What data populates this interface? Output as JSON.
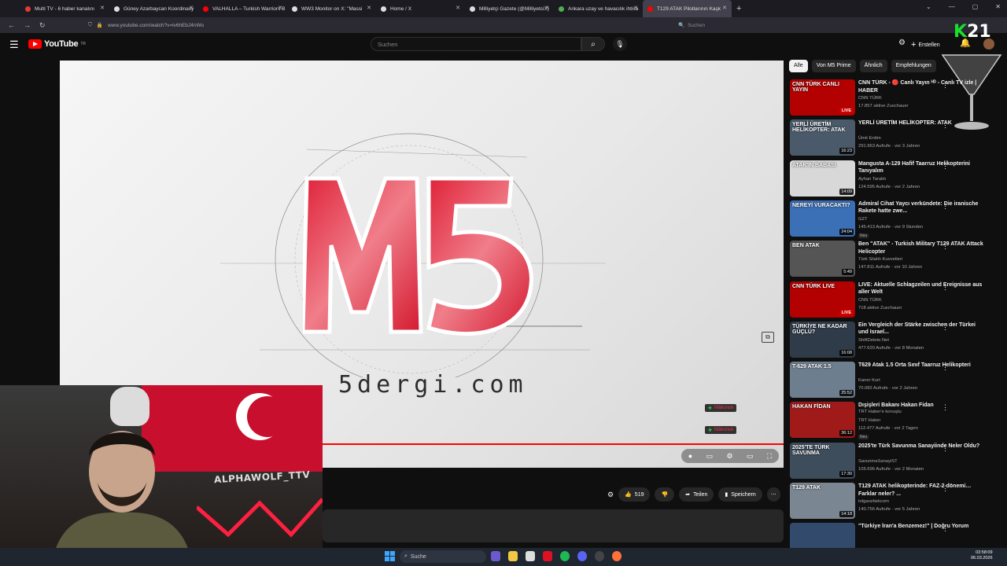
{
  "browser": {
    "tabs": [
      {
        "label": "Multi TV - 6 haber kanalını",
        "color": "#e53935"
      },
      {
        "label": "Güney Azarbaycan Koordinasy",
        "color": "#ffffff"
      },
      {
        "label": "VALHALLA – Turkish Warriors B",
        "color": "#ff0000"
      },
      {
        "label": "WW3 Monitor on X: \"Massi",
        "color": "#ffffff"
      },
      {
        "label": "Home / X",
        "color": "#ffffff"
      },
      {
        "label": "Milliyetçi Gazete (@MilliyetciX)",
        "color": "#ffffff"
      },
      {
        "label": "Ankara uzay ve havacılık ihtisa",
        "color": "#4caf50"
      },
      {
        "label": "T129 ATAK Pilotlarının Kaşk",
        "color": "#ff0000"
      }
    ],
    "url": "www.youtube.com/watch?v=lv6hEbJ4nWo",
    "search_placeholder": "Suchen"
  },
  "header": {
    "logo": "YouTube",
    "logo_country": "TR",
    "search_placeholder": "Suchen",
    "create_label": "Erstellen"
  },
  "player": {
    "site_text": "5dergi.com",
    "logo_text": "M5",
    "chat_1": "Mâkonuk",
    "chat_2": "Mâkonuk",
    "streamer_tag": "ALPHAWOLF_TTV"
  },
  "actions": {
    "likes": "519",
    "share": "Teilen",
    "save": "Speichern"
  },
  "chips": [
    "Alle",
    "Von M5 Prime",
    "Ähnlich",
    "Empfehlungen"
  ],
  "videos": [
    {
      "title": "CNN TÜRK - 🔴 Canlı Yayın ᴴᴰ - Canlı TV izle | HABER",
      "channel": "CNN TÜRK",
      "meta": "17.857 aktive Zuschauer",
      "badge": "LIVE",
      "thumb_text": "CNN TÜRK CANLI YAYIN",
      "thumb_color": "#b30000"
    },
    {
      "title": "YERLİ ÜRETİM HELİKOPTER: ATAK",
      "channel": "Ümit Erdim",
      "meta": "291.963 Aufrufe · vor 3 Jahren",
      "badge": "16:23",
      "thumb_text": "YERLİ ÜRETİM HELİKOPTER: ATAK",
      "thumb_color": "#4a5a6a"
    },
    {
      "title": "Mangusta A-129 Hafif Taarruz Helikopterini Tanıyalım",
      "channel": "Ayhan Taraktı",
      "meta": "124.595 Aufrufe · vor 2 Jahren",
      "badge": "14:09",
      "thumb_text": "ATAK'IN BABASI",
      "thumb_color": "#d8d8d8"
    },
    {
      "title": "Admiral Cihat Yaycı verkündete: Die iranische Rakete hatte zwe...",
      "channel": "GZT",
      "meta": "145.413 Aufrufe · vor 9 Stunden",
      "badge": "24:04",
      "thumb_text": "NEREYİ VURACAKTI?",
      "thumb_color": "#3b6fb6",
      "new": "Neu"
    },
    {
      "title": "Ben \"ATAK\" - Turkish Military T129 ATAK Attack Helicopter",
      "channel": "Türk Silahlı Kuvvetleri",
      "meta": "147.811 Aufrufe · vor 10 Jahren",
      "badge": "5:49",
      "thumb_text": "BEN ATAK",
      "thumb_color": "#555"
    },
    {
      "title": "LIVE: Aktuelle Schlagzeilen und Ereignisse aus aller Welt",
      "channel": "CNN TÜRK",
      "meta": "718 aktive Zuschauer",
      "badge": "LIVE",
      "thumb_text": "CNN TÜRK LIVE",
      "thumb_color": "#b30000"
    },
    {
      "title": "Ein Vergleich der Stärke zwischen der Türkei und Israel...",
      "channel": "ShiftDelete.Net",
      "meta": "477.620 Aufrufe · vor 8 Monaten",
      "badge": "16:08",
      "thumb_text": "TÜRKİYE NE KADAR GÜÇLÜ?",
      "thumb_color": "#2f3b48"
    },
    {
      "title": "T629 Atak 1.5 Orta Sınıf Taarruz Helikopteri",
      "channel": "Kaner Kurt",
      "meta": "70.082 Aufrufe · vor 2 Jahren",
      "badge": "25:52",
      "thumb_text": "T-629 ATAK 1.5",
      "thumb_color": "#6d7f8f"
    },
    {
      "title": "Dışişleri Bakanı Hakan Fidan",
      "channel": "TRT Haber",
      "meta": "112.477 Aufrufe · vor 2 Tagen",
      "badge": "36:12",
      "thumb_text": "HAKAN FİDAN",
      "thumb_color": "#a01a1a",
      "new": "Neu",
      "subtitle": "TRT Haber'e konuştu"
    },
    {
      "title": "2025'te Türk Savunma Sanayiinde Neler Oldu?",
      "channel": "SavunmaSanayiST",
      "meta": "105.696 Aufrufe · vor 2 Monaten",
      "badge": "17:30",
      "thumb_text": "2025'TE TÜRK SAVUNMA",
      "thumb_color": "#3e4d5c"
    },
    {
      "title": "T129 ATAK helikopterinde: FAZ-2 dönemi… Farklar neler? ...",
      "channel": "tolgaozbekcom",
      "meta": "140.756 Aufrufe · vor 5 Jahren",
      "badge": "14:18",
      "thumb_text": "T129 ATAK",
      "thumb_color": "#7a8691"
    },
    {
      "title": "\"Türkiye İran'a Benzemez!\" | Doğru Yorum",
      "channel": "",
      "meta": "",
      "badge": "",
      "thumb_text": "",
      "thumb_color": "#324a6b"
    }
  ],
  "overlay": {
    "k21": "21",
    "k21_letter": "K"
  },
  "taskbar": {
    "search": "Suche",
    "time": "03:58:09",
    "date": "06.03.2026"
  },
  "colors": {
    "yt_red": "#ff0000",
    "bg": "#0f0f0f",
    "chip_active": "#f1f1f1"
  }
}
